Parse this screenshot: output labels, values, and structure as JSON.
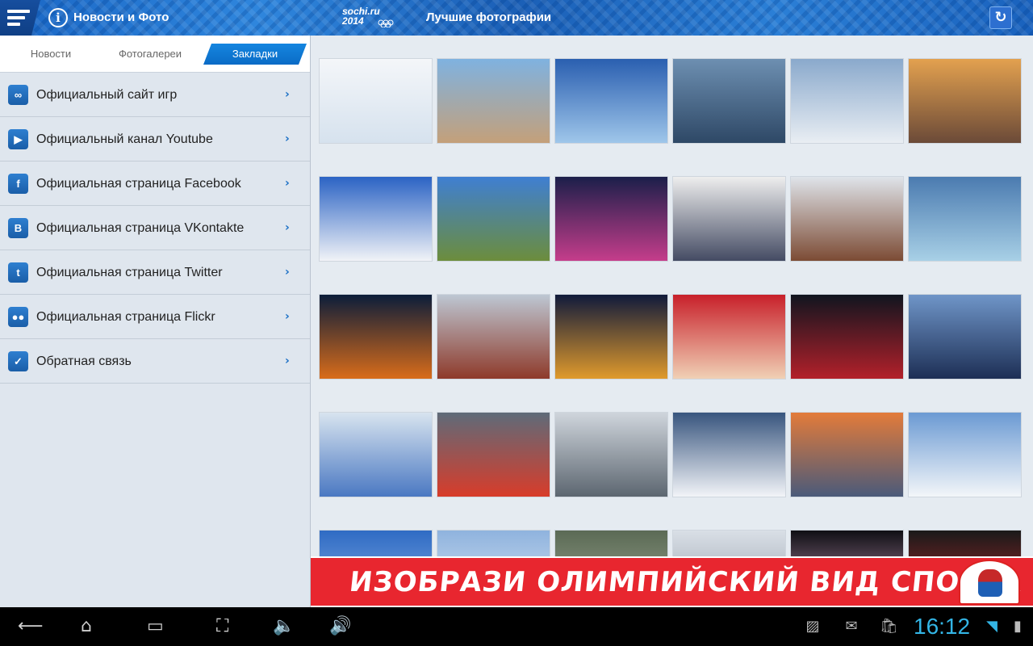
{
  "header": {
    "title": "Новости и Фото",
    "logo_line1": "sochi.ru",
    "logo_line2": "2014",
    "section_title": "Лучшие фотографии",
    "menu_icon": "hamburger-icon",
    "info_icon": "info-icon",
    "refresh_icon": "refresh-icon"
  },
  "tabs": [
    {
      "label": "Новости",
      "active": false
    },
    {
      "label": "Фотогалереи",
      "active": false
    },
    {
      "label": "Закладки",
      "active": true
    }
  ],
  "links": [
    {
      "label": "Официальный сайт игр",
      "icon": "olympic-rings-icon",
      "glyph": "∞"
    },
    {
      "label": "Официальный канал Youtube",
      "icon": "youtube-icon",
      "glyph": "▶"
    },
    {
      "label": "Официальная страница Facebook",
      "icon": "facebook-icon",
      "glyph": "f"
    },
    {
      "label": "Официальная страница VKontakte",
      "icon": "vkontakte-icon",
      "glyph": "В"
    },
    {
      "label": "Официальная страница Twitter",
      "icon": "twitter-icon",
      "glyph": "t"
    },
    {
      "label": "Официальная страница Flickr",
      "icon": "flickr-icon",
      "glyph": "●●"
    },
    {
      "label": "Обратная связь",
      "icon": "feedback-icon",
      "glyph": "✓"
    }
  ],
  "chevron": "›",
  "gallery": {
    "photos": [
      {
        "name": "mascots-snowboard-photo",
        "c1": "#f4f6f9",
        "c2": "#d6e2ee"
      },
      {
        "name": "arena-sunset-photo",
        "c1": "#7fb2e0",
        "c2": "#c4a07a"
      },
      {
        "name": "iceberg-palace-photo",
        "c1": "#2a5fb0",
        "c2": "#9fc6ea"
      },
      {
        "name": "stadium-seats-photo",
        "c1": "#6d8fb1",
        "c2": "#2e4866"
      },
      {
        "name": "mountain-village-photo",
        "c1": "#8aa9cc",
        "c2": "#e9eef3"
      },
      {
        "name": "snow-cannon-sunset-photo",
        "c1": "#e3a14f",
        "c2": "#6b4a38"
      },
      {
        "name": "palms-snow-photo",
        "c1": "#2b63c4",
        "c2": "#f1f3f7"
      },
      {
        "name": "palm-stadium-photo",
        "c1": "#3f7fd2",
        "c2": "#6c8d3c"
      },
      {
        "name": "fisht-stadium-night-photo",
        "c1": "#1b1f4a",
        "c2": "#c53d8b"
      },
      {
        "name": "hockey-pucks-photo",
        "c1": "#eeeeee",
        "c2": "#444b63"
      },
      {
        "name": "horse-riders-photo",
        "c1": "#dfe4ea",
        "c2": "#7c4b34"
      },
      {
        "name": "countdown-clock-photo",
        "c1": "#4b7bb0",
        "c2": "#a8d0e6"
      },
      {
        "name": "torch-stage-photo",
        "c1": "#0b1d3a",
        "c2": "#d96c1a"
      },
      {
        "name": "reindeer-crowd-photo",
        "c1": "#bdc7d3",
        "c2": "#8e3a2a"
      },
      {
        "name": "torch-ceremony-photo",
        "c1": "#101a3b",
        "c2": "#e09a2c"
      },
      {
        "name": "torchbearer-portrait-photo",
        "c1": "#c8202a",
        "c2": "#f0d0b5"
      },
      {
        "name": "red-carpet-photo",
        "c1": "#10151f",
        "c2": "#b3202a"
      },
      {
        "name": "helicopter-photo",
        "c1": "#6f95c8",
        "c2": "#1d2f55"
      },
      {
        "name": "snow-maiden-photo",
        "c1": "#d8e4ef",
        "c2": "#4a78c2"
      },
      {
        "name": "rafting-photo",
        "c1": "#5e6b79",
        "c2": "#d83c2a"
      },
      {
        "name": "bobsleigh-track-photo",
        "c1": "#cfd5dc",
        "c2": "#5c6670"
      },
      {
        "name": "skier-mountains-photo",
        "c1": "#38557e",
        "c2": "#f2f4f8"
      },
      {
        "name": "sunset-stadium-photo",
        "c1": "#e37b3a",
        "c2": "#4a5a7a"
      },
      {
        "name": "biathlon-center-photo",
        "c1": "#6b9ad3",
        "c2": "#f3f6f9"
      },
      {
        "name": "sky-photo",
        "c1": "#2f6bc4",
        "c2": "#8fb5e6"
      },
      {
        "name": "snowy-sky-photo",
        "c1": "#8fb3de",
        "c2": "#dfe9f3"
      },
      {
        "name": "village-aerial-photo",
        "c1": "#5b6a55",
        "c2": "#a3ad98"
      },
      {
        "name": "building-facade-photo",
        "c1": "#d9dfe6",
        "c2": "#8f99a5"
      },
      {
        "name": "figure-skater-photo",
        "c1": "#0f0f14",
        "c2": "#d7a6c8"
      },
      {
        "name": "red-costume-photo",
        "c1": "#1a1a1a",
        "c2": "#c4292c"
      }
    ]
  },
  "banner": {
    "text": "ИЗОБРАЗИ ОЛИМПИЙСКИЙ ВИД СПОРТА",
    "badge_icon": "athlete-mascot-icon"
  },
  "system": {
    "clock": "16:12",
    "nav": [
      {
        "name": "back-icon",
        "glyph": "⟵"
      },
      {
        "name": "home-icon",
        "glyph": "⌂"
      },
      {
        "name": "recent-apps-icon",
        "glyph": "▭"
      },
      {
        "name": "screenshot-icon",
        "glyph": "⛶"
      },
      {
        "name": "volume-down-icon",
        "glyph": "🔈"
      },
      {
        "name": "volume-up-icon",
        "glyph": "🔊"
      }
    ],
    "status": [
      {
        "name": "gallery-notification-icon",
        "glyph": "▨"
      },
      {
        "name": "gmail-notification-icon",
        "glyph": "✉"
      },
      {
        "name": "store-notification-icon",
        "glyph": "🛍"
      },
      {
        "name": "wifi-icon",
        "glyph": "◥"
      },
      {
        "name": "battery-icon",
        "glyph": "▮"
      }
    ]
  }
}
